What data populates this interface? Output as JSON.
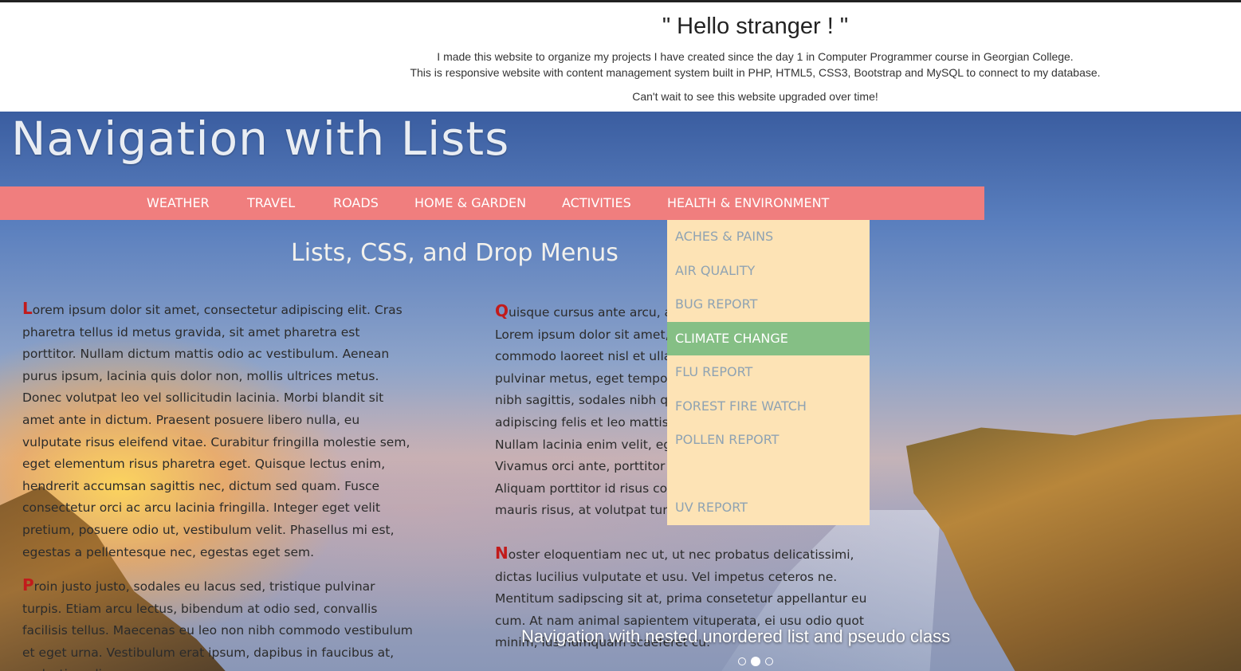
{
  "intro": {
    "title": "\" Hello stranger ! \"",
    "line1": "I made this website to organize my projects I have created since the day 1 in Computer Programmer course in Georgian College.",
    "line2": "This is responsive website with content management system built in PHP, HTML5, CSS3, Bootstrap and MySQL to connect to my database.",
    "line3": "Can't wait to see this website upgraded over time!"
  },
  "demo": {
    "title": "Navigation with Lists",
    "menu": [
      "WEATHER",
      "TRAVEL",
      "ROADS",
      "HOME & GARDEN",
      "ACTIVITIES",
      "HEALTH & ENVIRONMENT"
    ],
    "dropdown": [
      "ACHES & PAINS",
      "AIR QUALITY",
      "BUG REPORT",
      "CLIMATE CHANGE",
      "FLU REPORT",
      "FOREST FIRE WATCH",
      "POLLEN REPORT",
      "UV REPORT"
    ],
    "active_dropdown_item": "CLIMATE CHANGE",
    "heading": "Lists, CSS, and Drop Menus",
    "col1": {
      "p1_cap": "L",
      "p1": "orem ipsum dolor sit amet, consectetur adipiscing elit. Cras pharetra tellus id metus gravida, sit amet pharetra est porttitor. Nullam dictum mattis odio ac vestibulum. Aenean purus ipsum, lacinia quis dolor non, mollis ultrices metus. Donec volutpat leo vel sollicitudin lacinia. Morbi blandit sit amet ante in dictum. Praesent posuere libero nulla, eu vulputate risus eleifend vitae. Curabitur fringilla molestie sem, eget elementum risus pharetra eget. Quisque lectus enim, hendrerit accumsan sagittis nec, dictum sed quam. Fusce consectetur orci ac arcu lacinia fringilla. Integer eget velit pretium, posuere odio ut, vestibulum velit. Phasellus mi est, egestas a pellentesque nec, egestas eget sem.",
      "p2_cap": "P",
      "p2": "roin justo justo, sodales eu lacus sed, tristique pulvinar turpis. Etiam arcu lectus, bibendum at odio sed, convallis facilisis tellus. Maecenas eu leo non nibh commodo vestibulum et eget urna. Vestibulum erat ipsum, dapibus in faucibus at, molestie a diam."
    },
    "col2": {
      "p1_cap": "Q",
      "p1_lines": [
        "uisque cursus ante arcu, ac",
        "Lorem ipsum dolor sit amet,",
        "commodo laoreet nisl et ulla",
        "pulvinar metus, eget tempor",
        "nibh sagittis, sodales nibh qu",
        "adipiscing felis et leo mattis,",
        "Nullam lacinia enim velit, eg",
        "Vivamus orci ante, porttitor u",
        "Aliquam porttitor id risus cor",
        "mauris risus, at volutpat turp"
      ],
      "p2_cap": "N",
      "p2": "oster eloquentiam nec ut, ut nec probatus delicatissimi, dictas lucilius vulputate et usu. Vel impetus ceteros ne. Mentitum sadipscing sit at, prima consetetur appellantur eu cum. At nam animal sapientem vituperata, ei usu odio quot minim, ius numquam scaeferet cu."
    },
    "caption": "Navigation with nested unordered list and pseudo class",
    "carousel_active_index": 1
  },
  "colors": {
    "menubar": "#f07e7e",
    "dropdown_bg": "#fde3b5",
    "dropdown_active": "#85bf85",
    "dropcap": "#c21b1b"
  }
}
